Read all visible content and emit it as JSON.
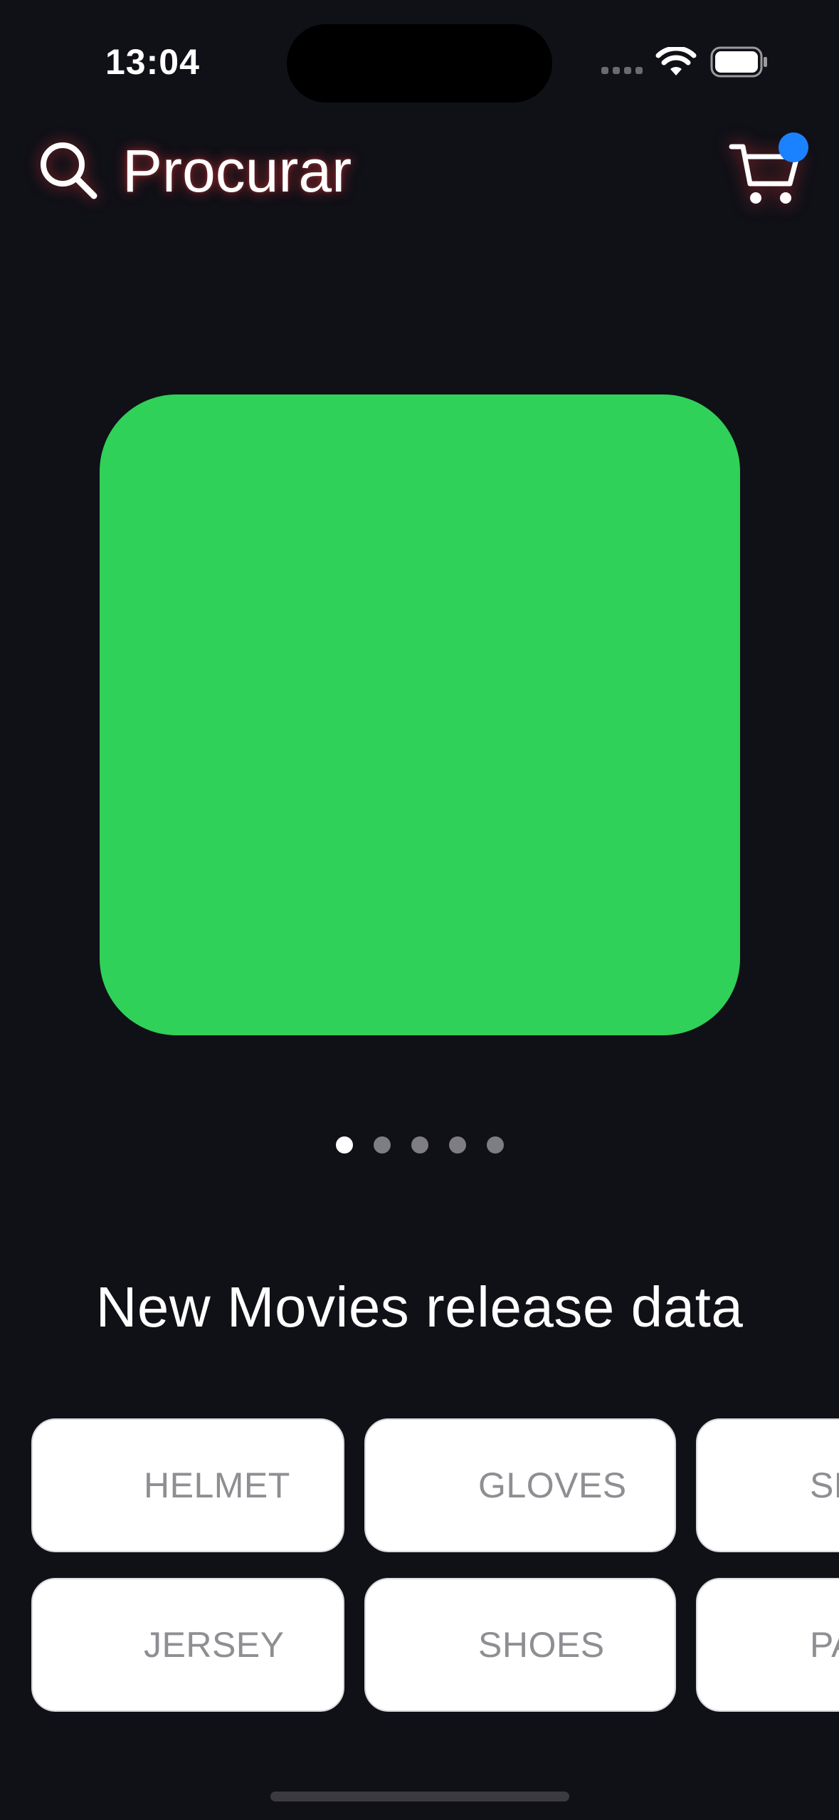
{
  "status_bar": {
    "time": "13:04"
  },
  "header": {
    "search_label": "Procurar",
    "search_icon": "search-icon",
    "cart_icon": "cart-icon",
    "cart_badge_color": "#1a82ff"
  },
  "carousel": {
    "slide_color": "#30d158",
    "page_count": 5,
    "active_page": 1
  },
  "section": {
    "title": "New Movies release data"
  },
  "categories": [
    {
      "label": "HELMET"
    },
    {
      "label": "GLOVES"
    },
    {
      "label": "SH"
    },
    {
      "label": "JERSEY"
    },
    {
      "label": "SHOES"
    },
    {
      "label": "PA"
    }
  ],
  "colors": {
    "background": "#101017",
    "glow": "#ff3c3c"
  }
}
